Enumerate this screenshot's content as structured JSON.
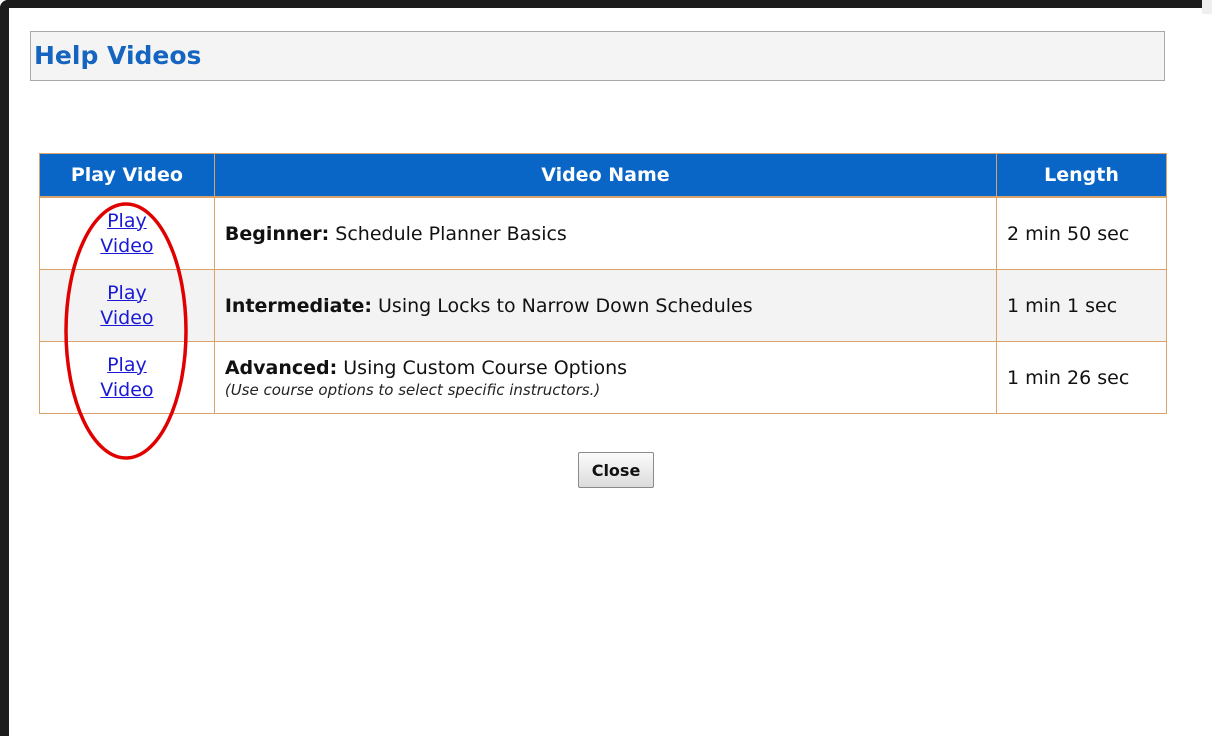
{
  "dialog": {
    "title": "Help Videos"
  },
  "table": {
    "headers": {
      "play": "Play Video",
      "name": "Video Name",
      "length": "Length"
    },
    "rows": [
      {
        "play_line1": "Play",
        "play_line2": "Video",
        "level": "Beginner:",
        "title": " Schedule Planner Basics",
        "note": "",
        "length": "2 min 50 sec"
      },
      {
        "play_line1": "Play",
        "play_line2": "Video",
        "level": "Intermediate:",
        "title": " Using Locks to Narrow Down Schedules",
        "note": "",
        "length": "1 min 1 sec"
      },
      {
        "play_line1": "Play",
        "play_line2": "Video",
        "level": "Advanced:",
        "title": " Using Custom Course Options",
        "note": "(Use course options to select specific instructors.)",
        "length": "1 min 26 sec"
      }
    ]
  },
  "buttons": {
    "close_label": "Close"
  },
  "colors": {
    "header_bg": "#0966c6",
    "title_text": "#1565c0",
    "link": "#1a1ad6",
    "cell_border": "#d9a36a",
    "annotation": "#e00000"
  }
}
